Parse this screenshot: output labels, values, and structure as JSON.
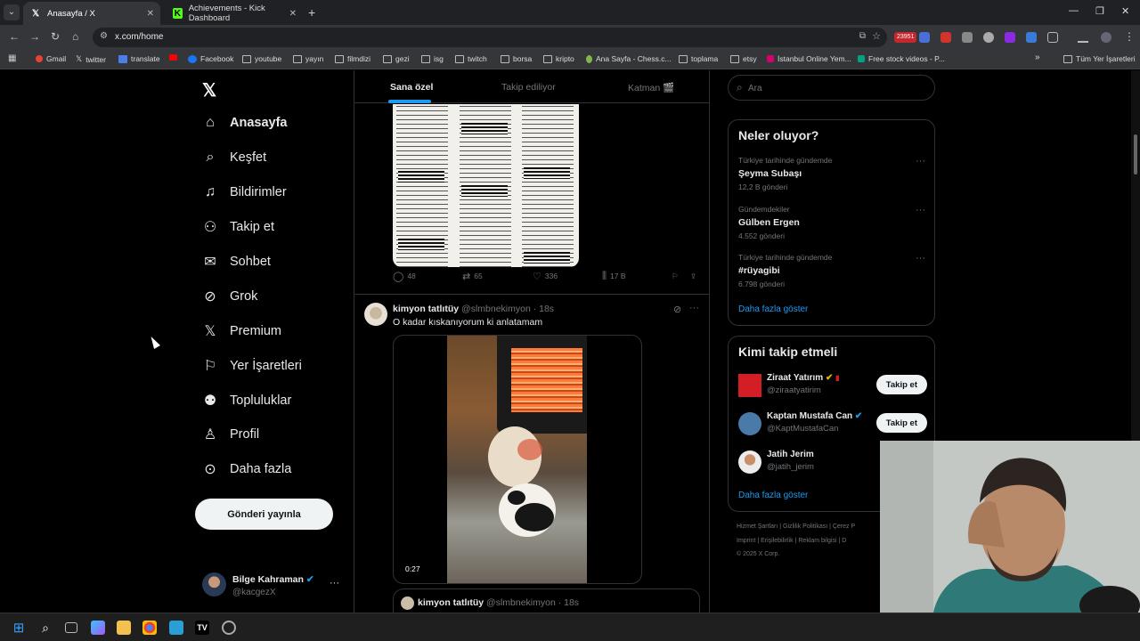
{
  "browser": {
    "tabs": [
      {
        "title": "Anasayfa / X",
        "active": true
      },
      {
        "title": "Achievements - Kick Dashboard",
        "active": false
      }
    ],
    "url": "x.com/home",
    "ext_badge": "23951",
    "bookmarks": [
      "Gmail",
      "twitter",
      "translate",
      "Facebook",
      "youtube",
      "yayın",
      "filmdizi",
      "gezi",
      "isg",
      "twitch",
      "borsa",
      "kripto",
      "Ana Sayfa - Chess.c...",
      "toplama",
      "etsy",
      "İstanbul Online Yem...",
      "Free stock videos - P..."
    ],
    "all_bookmarks": "Tüm Yer İşaretleri"
  },
  "sidebar": {
    "logo": "𝕏",
    "items": [
      {
        "label": "Anasayfa",
        "icon": "home-icon"
      },
      {
        "label": "Keşfet",
        "icon": "search-icon"
      },
      {
        "label": "Bildirimler",
        "icon": "bell-icon"
      },
      {
        "label": "Takip et",
        "icon": "follow-icon"
      },
      {
        "label": "Sohbet",
        "icon": "mail-icon"
      },
      {
        "label": "Grok",
        "icon": "grok-icon"
      },
      {
        "label": "Premium",
        "icon": "x-premium-icon"
      },
      {
        "label": "Yer İşaretleri",
        "icon": "bookmark-icon"
      },
      {
        "label": "Topluluklar",
        "icon": "communities-icon"
      },
      {
        "label": "Profil",
        "icon": "profile-icon"
      },
      {
        "label": "Daha fazla",
        "icon": "more-circle-icon"
      }
    ],
    "post_button": "Gönderi yayınla",
    "account": {
      "name": "Bilge Kahraman",
      "handle": "@kacgezX",
      "more": "···"
    }
  },
  "feed": {
    "tabs": [
      "Sana özel",
      "Takip ediliyor",
      "Katman 🎬"
    ],
    "tweet1_stats": {
      "replies": "48",
      "retweets": "65",
      "likes": "336",
      "views": "17 B"
    },
    "tweet2": {
      "name": "kimyon tatlıtüy",
      "handle": "@slmbnekimyon",
      "time": "· 18s",
      "text": "O kadar kıskanıyorum ki anlatamam",
      "video_time": "0:27"
    },
    "quoted": {
      "name": "kimyon tatlıtüy",
      "handle": "@slmbnekimyon",
      "time": "· 18s"
    }
  },
  "right": {
    "search_placeholder": "Ara",
    "trends_title": "Neler oluyor?",
    "trends": [
      {
        "context": "Türkiye tarihinde gündemde",
        "name": "Şeyma Subaşı",
        "count": "12,2 B gönderi"
      },
      {
        "context": "Gündemdekiler",
        "name": "Gülben Ergen",
        "count": "4.552 gönderi"
      },
      {
        "context": "Türkiye tarihinde gündemde",
        "name": "#rüyagibi",
        "count": "6.798 gönderi"
      }
    ],
    "show_more": "Daha fazla göster",
    "who_title": "Kimi takip etmeli",
    "who": [
      {
        "name": "Ziraat Yatırım",
        "handle": "@ziraatyatirim",
        "button": "Takip et",
        "color": "#d41e26"
      },
      {
        "name": "Kaptan Mustafa Can",
        "handle": "@KaptMustafaCan",
        "button": "Takip et",
        "color": "#4a7aa8"
      },
      {
        "name": "Jatih Jerim",
        "handle": "@jatih_jerim",
        "button": "",
        "color": "#e8d8c8"
      }
    ],
    "who_more": "Daha fazla göster",
    "footer1": "Hizmet Şartları  |  Gizlilik Politikası  |  Çerez P",
    "footer2": "Imprint  |  Erişilebilirlik  |  Reklam bilgisi  |  D",
    "footer3": "© 2025 X Corp."
  },
  "colors": {
    "accent": "#1d9bf0",
    "bg": "#000000",
    "border": "#2f3336",
    "muted": "#71767b"
  }
}
